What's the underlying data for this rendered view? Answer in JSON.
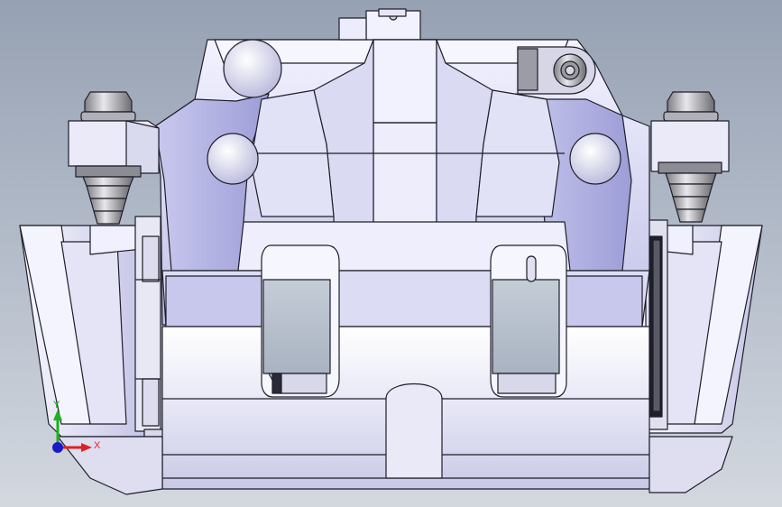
{
  "viewport": {
    "background_top": "#96a1b3",
    "background_bottom": "#d3d8df"
  },
  "model": {
    "body_color": "#ececf8",
    "shade_color": "#b9b9e4",
    "edge_color": "#1e1e2a",
    "metal_color": "#c8c8ce"
  },
  "triad": {
    "x_label": "X",
    "y_label": "Y",
    "x_color": "#e02020",
    "y_color": "#1bb21b",
    "z_color": "#1a1acc"
  }
}
